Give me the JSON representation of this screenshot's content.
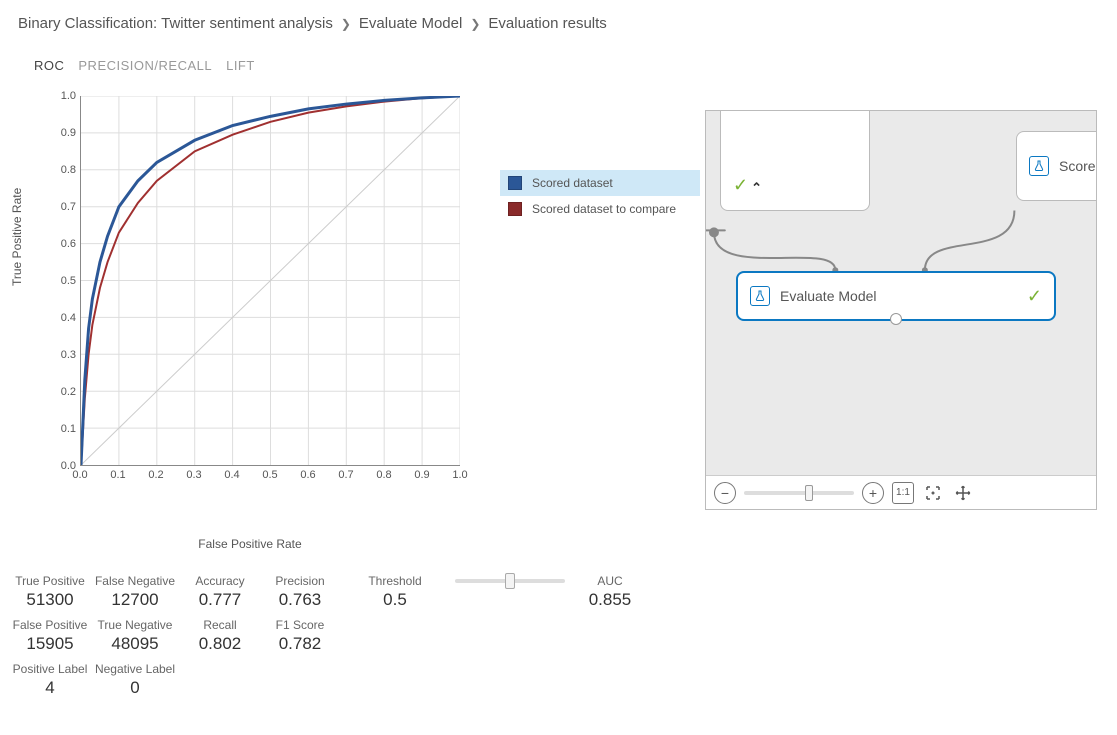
{
  "breadcrumb": {
    "a": "Binary Classification: Twitter sentiment analysis",
    "b": "Evaluate Model",
    "c": "Evaluation results"
  },
  "tabs": {
    "roc": "ROC",
    "pr": "PRECISION/RECALL",
    "lift": "LIFT"
  },
  "chart_data": {
    "type": "line",
    "title": "",
    "xlabel": "False Positive Rate",
    "ylabel": "True Positive Rate",
    "xlim": [
      0,
      1
    ],
    "ylim": [
      0,
      1
    ],
    "xticks": [
      0.0,
      0.1,
      0.2,
      0.3,
      0.4,
      0.5,
      0.6,
      0.7,
      0.8,
      0.9,
      1.0
    ],
    "yticks": [
      0.0,
      0.1,
      0.2,
      0.3,
      0.4,
      0.5,
      0.6,
      0.7,
      0.8,
      0.9,
      1.0
    ],
    "diagonal": true,
    "series": [
      {
        "name": "Scored dataset",
        "color": "#2b5797",
        "x": [
          0.0,
          0.01,
          0.02,
          0.03,
          0.05,
          0.07,
          0.1,
          0.15,
          0.2,
          0.3,
          0.4,
          0.5,
          0.6,
          0.7,
          0.8,
          0.9,
          1.0
        ],
        "y": [
          0.0,
          0.23,
          0.37,
          0.45,
          0.55,
          0.62,
          0.7,
          0.77,
          0.82,
          0.88,
          0.92,
          0.945,
          0.965,
          0.978,
          0.988,
          0.995,
          1.0
        ]
      },
      {
        "name": "Scored dataset to compare",
        "color": "#a03030",
        "x": [
          0.0,
          0.01,
          0.02,
          0.03,
          0.05,
          0.07,
          0.1,
          0.15,
          0.2,
          0.3,
          0.4,
          0.5,
          0.6,
          0.7,
          0.8,
          0.9,
          1.0
        ],
        "y": [
          0.0,
          0.18,
          0.3,
          0.38,
          0.48,
          0.55,
          0.63,
          0.71,
          0.77,
          0.85,
          0.895,
          0.93,
          0.955,
          0.972,
          0.985,
          0.994,
          1.0
        ]
      }
    ]
  },
  "legend": {
    "a": "Scored dataset",
    "b": "Scored dataset to compare"
  },
  "metrics": {
    "tp_label": "True Positive",
    "tp": "51300",
    "fn_label": "False Negative",
    "fn": "12700",
    "acc_label": "Accuracy",
    "acc": "0.777",
    "prec_label": "Precision",
    "prec": "0.763",
    "thr_label": "Threshold",
    "thr": "0.5",
    "auc_label": "AUC",
    "auc": "0.855",
    "fp_label": "False Positive",
    "fp": "15905",
    "tn_label": "True Negative",
    "tn": "48095",
    "rec_label": "Recall",
    "rec": "0.802",
    "f1_label": "F1 Score",
    "f1": "0.782",
    "pl_label": "Positive Label",
    "pl": "4",
    "nl_label": "Negative Label",
    "nl": "0"
  },
  "designer": {
    "node_eval": "Evaluate Model",
    "node_right": "Score",
    "toolbar": {
      "one_to_one": "1:1"
    }
  },
  "icons": {
    "check": "✓",
    "caret_up": "⌃",
    "minus": "−",
    "plus": "+"
  },
  "colors": {
    "accent": "#0b78c2",
    "series1": "#2b5797",
    "series2": "#a03030",
    "ok": "#7bb335"
  }
}
